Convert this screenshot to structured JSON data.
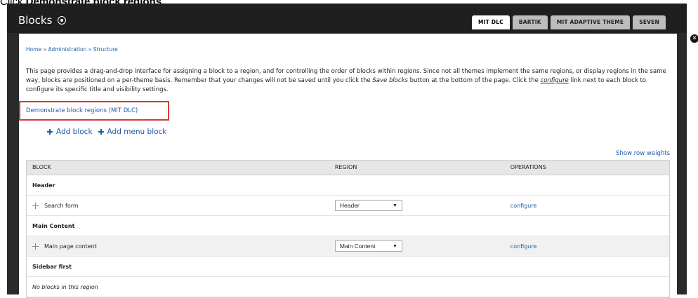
{
  "instruction": {
    "prefix": "Click ",
    "target": "Demonstrate block regions",
    "suffix": "."
  },
  "page": {
    "title": "Blocks"
  },
  "tabs": [
    {
      "label": "MIT DLC",
      "active": true
    },
    {
      "label": "BARTIK"
    },
    {
      "label": "MIT ADAPTIVE THEME"
    },
    {
      "label": "SEVEN"
    }
  ],
  "breadcrumb": "Home » Administration » Structure",
  "description": {
    "part1": "This page provides a drag-and-drop interface for assigning a block to a region, and for controlling the order of blocks within regions. Since not all themes implement the same regions, or display regions in the same way, blocks are positioned on a per-theme basis. Remember that your changes will not be saved until you click the ",
    "save_label": "Save blocks",
    "part2": " button at the bottom of the page. Click the ",
    "configure_word": "configure",
    "part3": " link next to each block to configure its specific title and visibility settings."
  },
  "demo_link": "Demonstrate block regions (MIT DLC)",
  "actions": {
    "add_block": "Add block",
    "add_menu_block": "Add menu block"
  },
  "row_weights": "Show row weights",
  "table": {
    "headers": {
      "block": "BLOCK",
      "region": "REGION",
      "operations": "OPERATIONS"
    },
    "regions": [
      {
        "name": "Header",
        "blocks": [
          {
            "label": "Search form",
            "region": "Header",
            "op": "configure"
          }
        ]
      },
      {
        "name": "Main Content",
        "blocks": [
          {
            "label": "Main page content",
            "region": "Main Content",
            "op": "configure"
          }
        ]
      },
      {
        "name": "Sidebar first",
        "empty_text": "No blocks in this region"
      }
    ]
  },
  "icons": {
    "title": "circle-plus-icon",
    "add": "plus-icon",
    "drag": "drag-handle-icon",
    "close": "close-icon"
  },
  "colors": {
    "link": "#1a5aa8",
    "highlight": "#d93b30",
    "header_bg": "#1f1f1f"
  }
}
